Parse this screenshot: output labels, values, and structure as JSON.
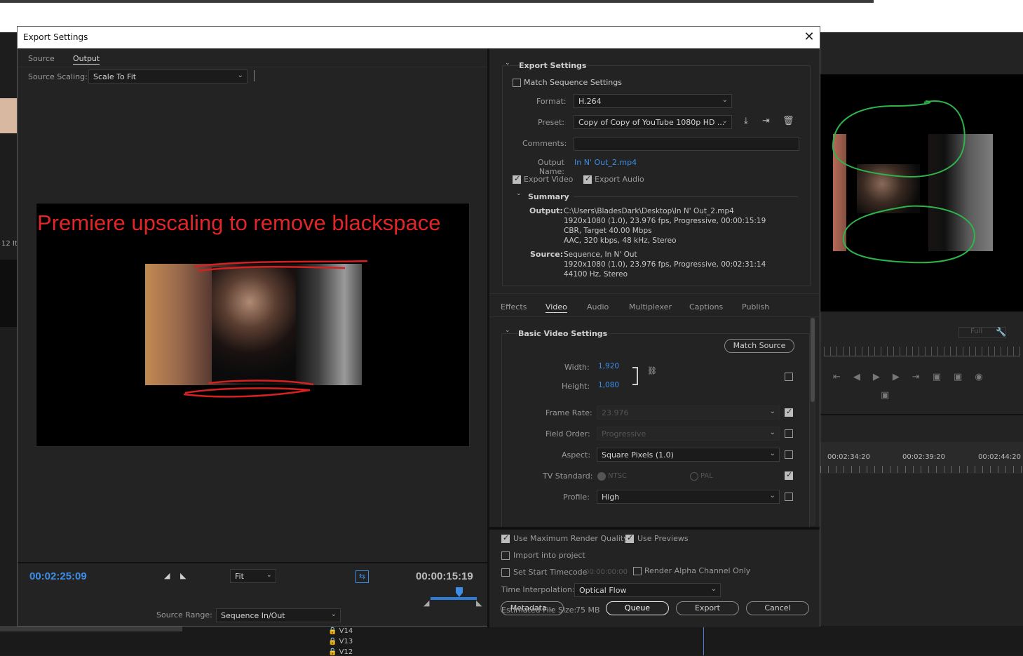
{
  "dialog": {
    "title": "Export Settings"
  },
  "left_tabs": [
    "Source",
    "Output"
  ],
  "source_scaling": {
    "label": "Source Scaling:",
    "value": "Scale To Fit"
  },
  "preview": {
    "caption": "Premiere upscaling to remove blackspace"
  },
  "transport": {
    "current_time": "00:02:25:09",
    "fit_value": "Fit",
    "duration": "00:00:15:19",
    "source_range_label": "Source Range:",
    "source_range_value": "Sequence In/Out"
  },
  "export_settings": {
    "header": "Export Settings",
    "match_sequence": "Match Sequence Settings",
    "format_label": "Format:",
    "format_value": "H.264",
    "preset_label": "Preset:",
    "preset_value": "Copy of Copy of YouTube 1080p HD ...",
    "comments_label": "Comments:",
    "comments_value": "",
    "output_name_label": "Output Name:",
    "output_name_value": "In N' Out_2.mp4",
    "export_video": "Export Video",
    "export_audio": "Export Audio",
    "summary_header": "Summary",
    "output_label": "Output:",
    "output_lines": [
      "C:\\Users\\BladesDark\\Desktop\\In N' Out_2.mp4",
      "1920x1080 (1.0), 23.976 fps, Progressive, 00:00:15:19",
      "CBR, Target 40.00 Mbps",
      "AAC, 320 kbps, 48 kHz, Stereo"
    ],
    "source_label": "Source:",
    "source_lines": [
      "Sequence, In N' Out",
      "1920x1080 (1.0), 23.976 fps, Progressive, 00:02:31:14",
      "44100 Hz, Stereo"
    ]
  },
  "settings_tabs": [
    "Effects",
    "Video",
    "Audio",
    "Multiplexer",
    "Captions",
    "Publish"
  ],
  "video": {
    "header": "Basic Video Settings",
    "match_source": "Match Source",
    "width_label": "Width:",
    "width_value": "1,920",
    "height_label": "Height:",
    "height_value": "1,080",
    "frame_rate_label": "Frame Rate:",
    "frame_rate_value": "23.976",
    "field_order_label": "Field Order:",
    "field_order_value": "Progressive",
    "aspect_label": "Aspect:",
    "aspect_value": "Square Pixels (1.0)",
    "tv_standard_label": "TV Standard:",
    "tv_ntsc": "NTSC",
    "tv_pal": "PAL",
    "profile_label": "Profile:",
    "profile_value": "High"
  },
  "bottom": {
    "use_max_render": "Use Maximum Render Quality",
    "use_previews": "Use Previews",
    "import_project": "Import into project",
    "set_start_tc": "Set Start Timecode",
    "start_tc_value": "00:00:00:00",
    "render_alpha": "Render Alpha Channel Only",
    "time_interp_label": "Time Interpolation:",
    "time_interp_value": "Optical Flow",
    "est_size_label": "Estimated File Size:",
    "est_size_value": "75 MB",
    "metadata_btn": "Metadata...",
    "queue_btn": "Queue",
    "export_btn": "Export",
    "cancel_btn": "Cancel"
  },
  "background": {
    "left_text": "12 It",
    "monitor_zoom": "Full",
    "ruler_times": [
      "00:02:34:20",
      "00:02:39:20",
      "00:02:44:20"
    ],
    "tracks": [
      "V14",
      "V13",
      "V12"
    ]
  }
}
